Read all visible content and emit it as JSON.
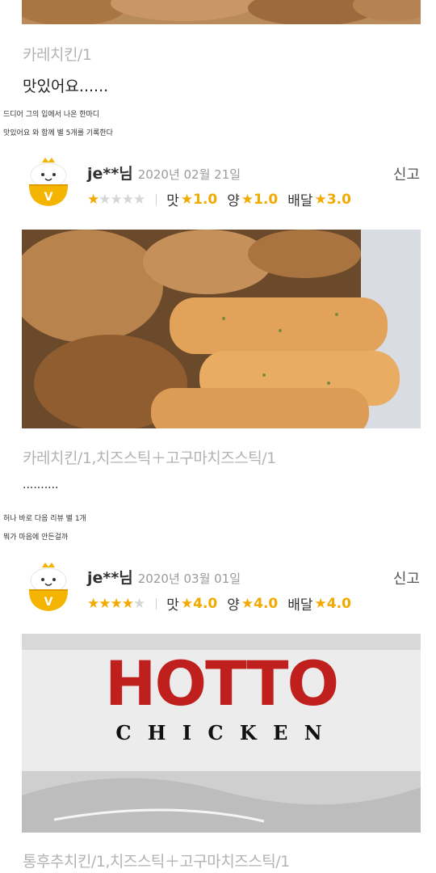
{
  "review_prev": {
    "menu": "카레치킨/1",
    "text": "맛있어요......",
    "captions": [
      "드디어 그의 입에서 나온 한마디",
      "맛있어요 와 함께 별 5개를 기록한다"
    ]
  },
  "review_1": {
    "username": "je**님",
    "date": "2020년 02월 21일",
    "report": "신고",
    "overall_rating": 1,
    "overall_max": 5,
    "taste_label": "맛",
    "taste": "1.0",
    "quantity_label": "양",
    "quantity": "1.0",
    "delivery_label": "배달",
    "delivery": "3.0",
    "menu": "카레치킨/1,치즈스틱＋고구마치즈스틱/1",
    "text": "..........",
    "captions": [
      "허나 바로 다음 리뷰 별 1개",
      "뭐가 마음에 안든걸까"
    ]
  },
  "review_2": {
    "username": "je**님",
    "date": "2020년 03월 01일",
    "report": "신고",
    "overall_rating": 4,
    "overall_max": 5,
    "taste_label": "맛",
    "taste": "4.0",
    "quantity_label": "양",
    "quantity": "4.0",
    "delivery_label": "배달",
    "delivery": "4.0",
    "box_brand": "HOTTO",
    "box_sub": "C H I C K E N",
    "menu": "통후추치킨/1,치즈스틱＋고구마치즈스틱/1"
  },
  "icons": {
    "star": "★",
    "avatar": "v-badge-mascot-icon"
  },
  "colors": {
    "star": "#f2a900",
    "star_off": "#d6d6d6",
    "badge": "#f4b400",
    "brand_red": "#c0201d"
  }
}
